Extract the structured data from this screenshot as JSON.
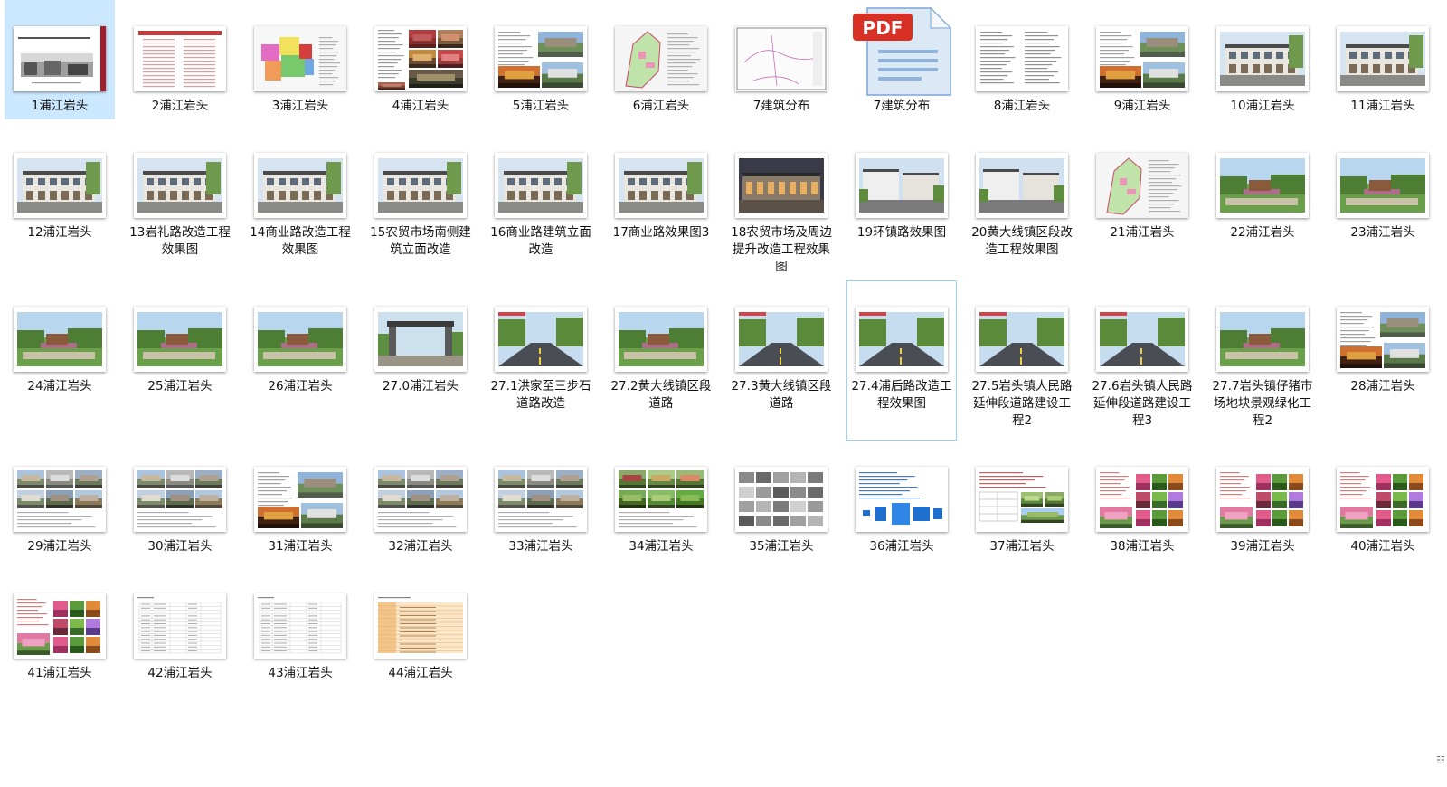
{
  "items": [
    {
      "label": "1浦江岩头",
      "kind": "cover",
      "selected": true
    },
    {
      "label": "2浦江岩头",
      "kind": "textlist"
    },
    {
      "label": "3浦江岩头",
      "kind": "map-color"
    },
    {
      "label": "4浦江岩头",
      "kind": "collage"
    },
    {
      "label": "5浦江岩头",
      "kind": "text-photo"
    },
    {
      "label": "6浦江岩头",
      "kind": "map-green"
    },
    {
      "label": "7建筑分布",
      "kind": "map-line"
    },
    {
      "label": "7建筑分布",
      "kind": "pdf"
    },
    {
      "label": "8浦江岩头",
      "kind": "text"
    },
    {
      "label": "9浦江岩头",
      "kind": "text-photo"
    },
    {
      "label": "10浦江岩头",
      "kind": "building"
    },
    {
      "label": "11浦江岩头",
      "kind": "building"
    },
    {
      "label": "12浦江岩头",
      "kind": "building"
    },
    {
      "label": "13岩礼路改造工程效果图",
      "kind": "building"
    },
    {
      "label": "14商业路改造工程效果图",
      "kind": "building"
    },
    {
      "label": "15农贸市场南侧建筑立面改造",
      "kind": "building"
    },
    {
      "label": "16商业路建筑立面改造",
      "kind": "building"
    },
    {
      "label": "17商业路效果图3",
      "kind": "building"
    },
    {
      "label": "18农贸市场及周边提升改造工程效果图",
      "kind": "building-dark"
    },
    {
      "label": "19环镇路效果图",
      "kind": "street"
    },
    {
      "label": "20黄大线镇区段改造工程效果图",
      "kind": "street"
    },
    {
      "label": "21浦江岩头",
      "kind": "map-green"
    },
    {
      "label": "22浦江岩头",
      "kind": "park"
    },
    {
      "label": "23浦江岩头",
      "kind": "park"
    },
    {
      "label": "24浦江岩头",
      "kind": "park"
    },
    {
      "label": "25浦江岩头",
      "kind": "park"
    },
    {
      "label": "26浦江岩头",
      "kind": "park"
    },
    {
      "label": "27.0浦江岩头",
      "kind": "gate"
    },
    {
      "label": "27.1洪家至三步石道路改造",
      "kind": "road"
    },
    {
      "label": "27.2黄大线镇区段道路",
      "kind": "park"
    },
    {
      "label": "27.3黄大线镇区段道路",
      "kind": "road"
    },
    {
      "label": "27.4浦后路改造工程效果图",
      "kind": "road",
      "hover": true
    },
    {
      "label": "27.5岩头镇人民路延伸段道路建设工程2",
      "kind": "road"
    },
    {
      "label": "27.6岩头镇人民路延伸段道路建设工程3",
      "kind": "road"
    },
    {
      "label": "27.7岩头镇仔猪市场地块景观绿化工程2",
      "kind": "park"
    },
    {
      "label": "28浦江岩头",
      "kind": "text-photo"
    },
    {
      "label": "29浦江岩头",
      "kind": "grid-photos"
    },
    {
      "label": "30浦江岩头",
      "kind": "grid-photos"
    },
    {
      "label": "31浦江岩头",
      "kind": "text-photo"
    },
    {
      "label": "32浦江岩头",
      "kind": "grid-photos"
    },
    {
      "label": "33浦江岩头",
      "kind": "grid-photos"
    },
    {
      "label": "34浦江岩头",
      "kind": "grid-green"
    },
    {
      "label": "35浦江岩头",
      "kind": "textures"
    },
    {
      "label": "36浦江岩头",
      "kind": "diagram"
    },
    {
      "label": "37浦江岩头",
      "kind": "table-photo"
    },
    {
      "label": "38浦江岩头",
      "kind": "plants"
    },
    {
      "label": "39浦江岩头",
      "kind": "plants"
    },
    {
      "label": "40浦江岩头",
      "kind": "plants"
    },
    {
      "label": "41浦江岩头",
      "kind": "plants"
    },
    {
      "label": "42浦江岩头",
      "kind": "table"
    },
    {
      "label": "43浦江岩头",
      "kind": "table"
    },
    {
      "label": "44浦江岩头",
      "kind": "table-color"
    }
  ],
  "colors": {
    "selection_bg": "#cce8ff",
    "hover_border": "#99d1ff",
    "pdf_badge": "#d93025",
    "pdf_page": "#dbe9f7"
  },
  "status_icon": "view-toggle-icon"
}
